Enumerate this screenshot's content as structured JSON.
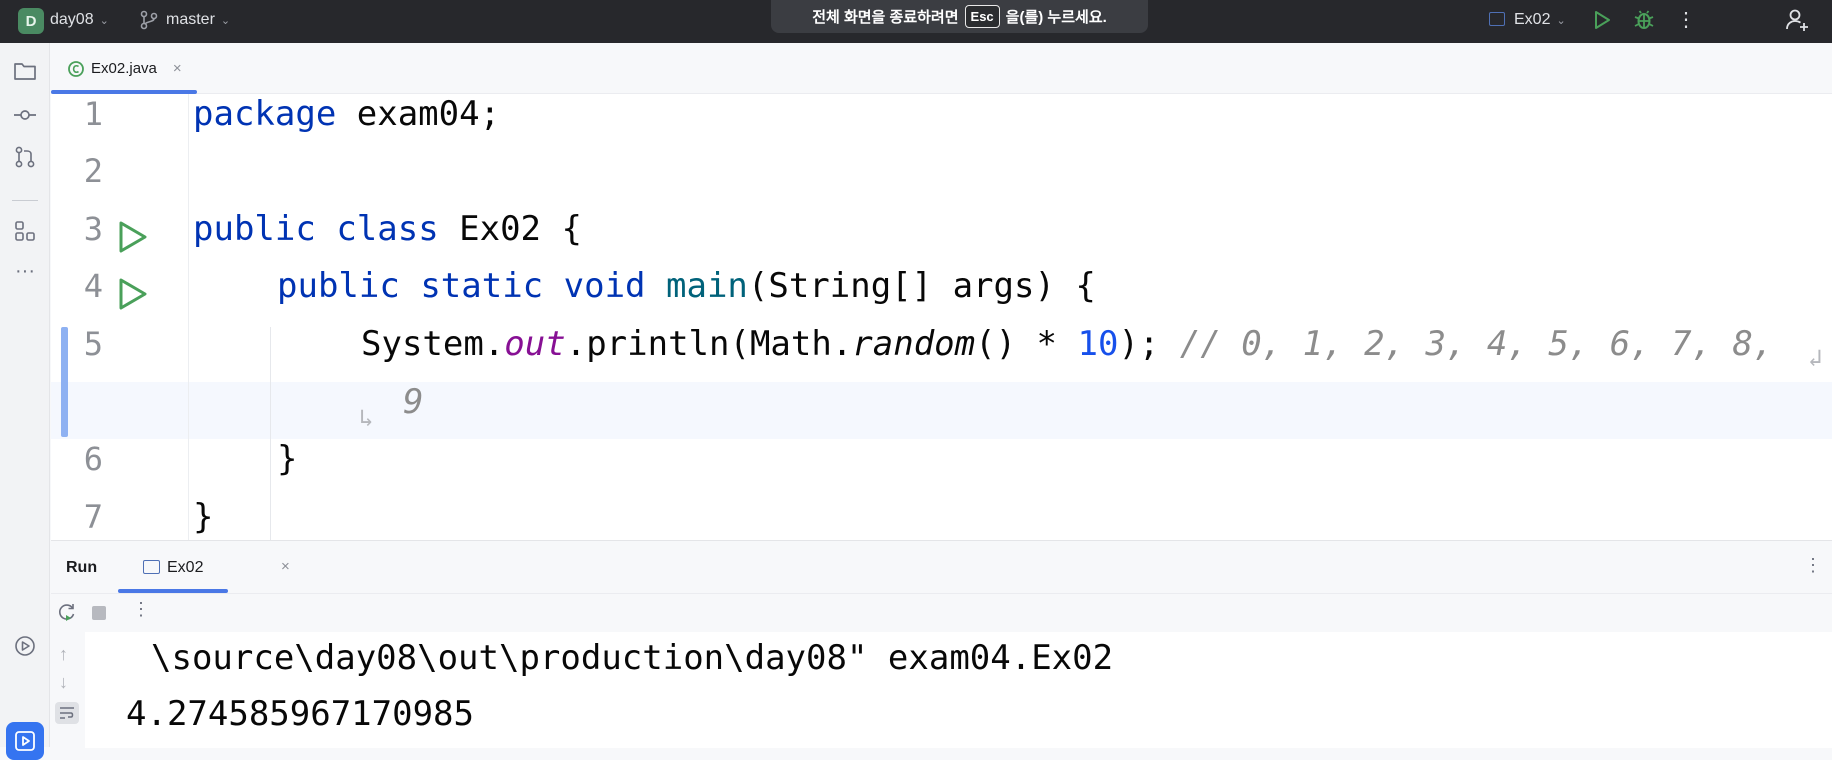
{
  "titlebar": {
    "project_badge": "D",
    "project_name": "day08",
    "branch": "master",
    "fullscreen_msg_before": "전체 화면을 종료하려면",
    "fullscreen_key": "Esc",
    "fullscreen_msg_after": "을(를) 누르세요.",
    "run_config": "Ex02"
  },
  "editor_tabs": [
    {
      "label": "Ex02.java",
      "close": "×"
    }
  ],
  "editor": {
    "line_numbers": [
      "1",
      "2",
      "3",
      "4",
      "5",
      "6",
      "7"
    ],
    "lines": {
      "l1_kw": "package",
      "l1_rest": " exam04;",
      "l3_kw1": "public",
      "l3_kw2": "class",
      "l3_rest": " Ex02 {",
      "l4_kw1": "public",
      "l4_kw2": "static",
      "l4_kw3": "void",
      "l4_fn": "main",
      "l4_rest": "(String[] args) {",
      "l5_a": "System.",
      "l5_field": "out",
      "l5_b": ".println(Math.",
      "l5_method": "random",
      "l5_c": "() * ",
      "l5_num": "10",
      "l5_d": "); ",
      "l5_comment": "// 0, 1, 2, 3, 4, 5, 6, 7, 8,",
      "l5_wrap_cont": "9",
      "l6": "}",
      "l7": "}"
    }
  },
  "run_panel": {
    "title": "Run",
    "tab_label": "Ex02",
    "tab_close": "×",
    "console": [
      "\\source\\day08\\out\\production\\day08\" exam04.Ex02",
      "4.274585967170985"
    ]
  },
  "colors": {
    "accent": "#3574f0",
    "keyword": "#0033b3",
    "function": "#00627a",
    "field": "#871094",
    "number": "#1750eb",
    "comment": "#8c8c8c",
    "run_green": "#4aa05a"
  }
}
